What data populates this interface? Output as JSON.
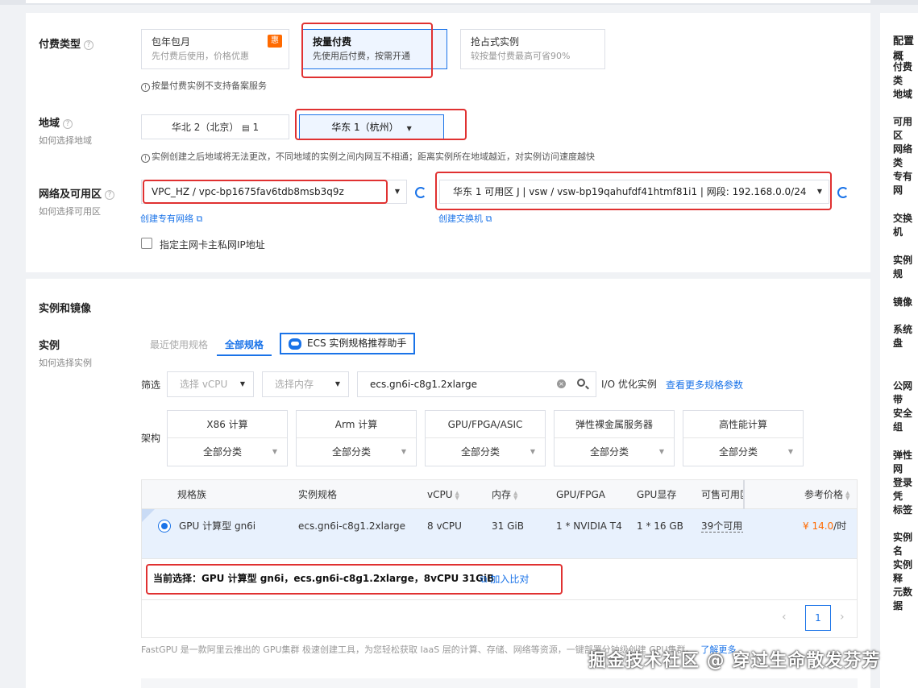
{
  "billing": {
    "label": "付费类型",
    "options": [
      {
        "title": "包年包月",
        "desc": "先付费后使用，价格优惠",
        "badge": "惠"
      },
      {
        "title": "按量付费",
        "desc": "先使用后付费，按需开通"
      },
      {
        "title": "抢占式实例",
        "desc": "较按量付费最高可省90%"
      }
    ],
    "note": "按量付费实例不支持备案服务"
  },
  "region": {
    "label": "地域",
    "help": "如何选择地域",
    "options": [
      {
        "label": "华北 2（北京）",
        "count": "1"
      },
      {
        "label": "华东 1（杭州）"
      }
    ],
    "note": "实例创建之后地域将无法更改，不同地域的实例之间内网互不相通；距离实例所在地域越近，对实例访问速度越快"
  },
  "network": {
    "label": "网络及可用区",
    "help": "如何选择可用区",
    "vpc": "VPC_HZ / vpc-bp1675fav6tdb8msb3q9z",
    "vswitch": "华东 1 可用区 J | vsw / vsw-bp19qahufdf41htmf81i1 | 网段: 192.168.0.0/24",
    "create_vpc": "创建专有网络",
    "create_vsw": "创建交换机",
    "assign_ip": "指定主网卡主私网IP地址"
  },
  "instance": {
    "section_title": "实例和镜像",
    "label": "实例",
    "help": "如何选择实例",
    "tabs": [
      "最近使用规格",
      "全部规格"
    ],
    "helper": "ECS 实例规格推荐助手",
    "filter_label": "筛选",
    "vcpu_placeholder": "选择 vCPU",
    "mem_placeholder": "选择内存",
    "search_value": "ecs.gn6i-c8g1.2xlarge",
    "io_label": "I/O 优化实例",
    "more_params": "查看更多规格参数",
    "arch_label": "架构",
    "arch": [
      {
        "name": "X86 计算",
        "value": "全部分类"
      },
      {
        "name": "Arm 计算",
        "value": "全部分类"
      },
      {
        "name": "GPU/FPGA/ASIC",
        "value": "全部分类"
      },
      {
        "name": "弹性裸金属服务器",
        "value": "全部分类"
      },
      {
        "name": "高性能计算",
        "value": "全部分类"
      }
    ],
    "columns": [
      "规格族",
      "实例规格",
      "vCPU",
      "内存",
      "GPU/FPGA",
      "GPU显存",
      "可售可用区",
      "参考价格"
    ],
    "row": {
      "family": "GPU 计算型 gn6i",
      "spec": "ecs.gn6i-c8g1.2xlarge",
      "vcpu": "8 vCPU",
      "mem": "31 GiB",
      "gpu": "1 * NVIDIA T4",
      "gpumem": "1 * 16 GB",
      "zones": "39个可用区",
      "price": "¥ 14.0",
      "unit": "/时"
    },
    "current": "当前选择：GPU 计算型 gn6i，ecs.gn6i-c8g1.2xlarge，8vCPU 31GiB",
    "compare": "加入比对",
    "page": "1",
    "footer": "FastGPU 是一款阿里云推出的 GPU集群 极速创建工具，为您轻松获取 IaaS 层的计算、存储、网络等资源，一键部署分钟级创建 GPU集群",
    "learn_more": "了解更多"
  },
  "sidebar": {
    "title": "配置概",
    "items": [
      "付费类",
      "地域",
      "可用区",
      "网络类",
      "专有网",
      "交换机",
      "实例规",
      "镜像",
      "系统盘",
      "公网带",
      "安全组",
      "弹性网",
      "登录凭",
      "标签",
      "实例名",
      "实例释",
      "元数据"
    ]
  },
  "watermark": "掘金技术社区 @ 穿过生命散发芬芳",
  "colors": {
    "accent": "#1a73e8",
    "highlight": "#e03131",
    "price": "#ff6a00"
  }
}
